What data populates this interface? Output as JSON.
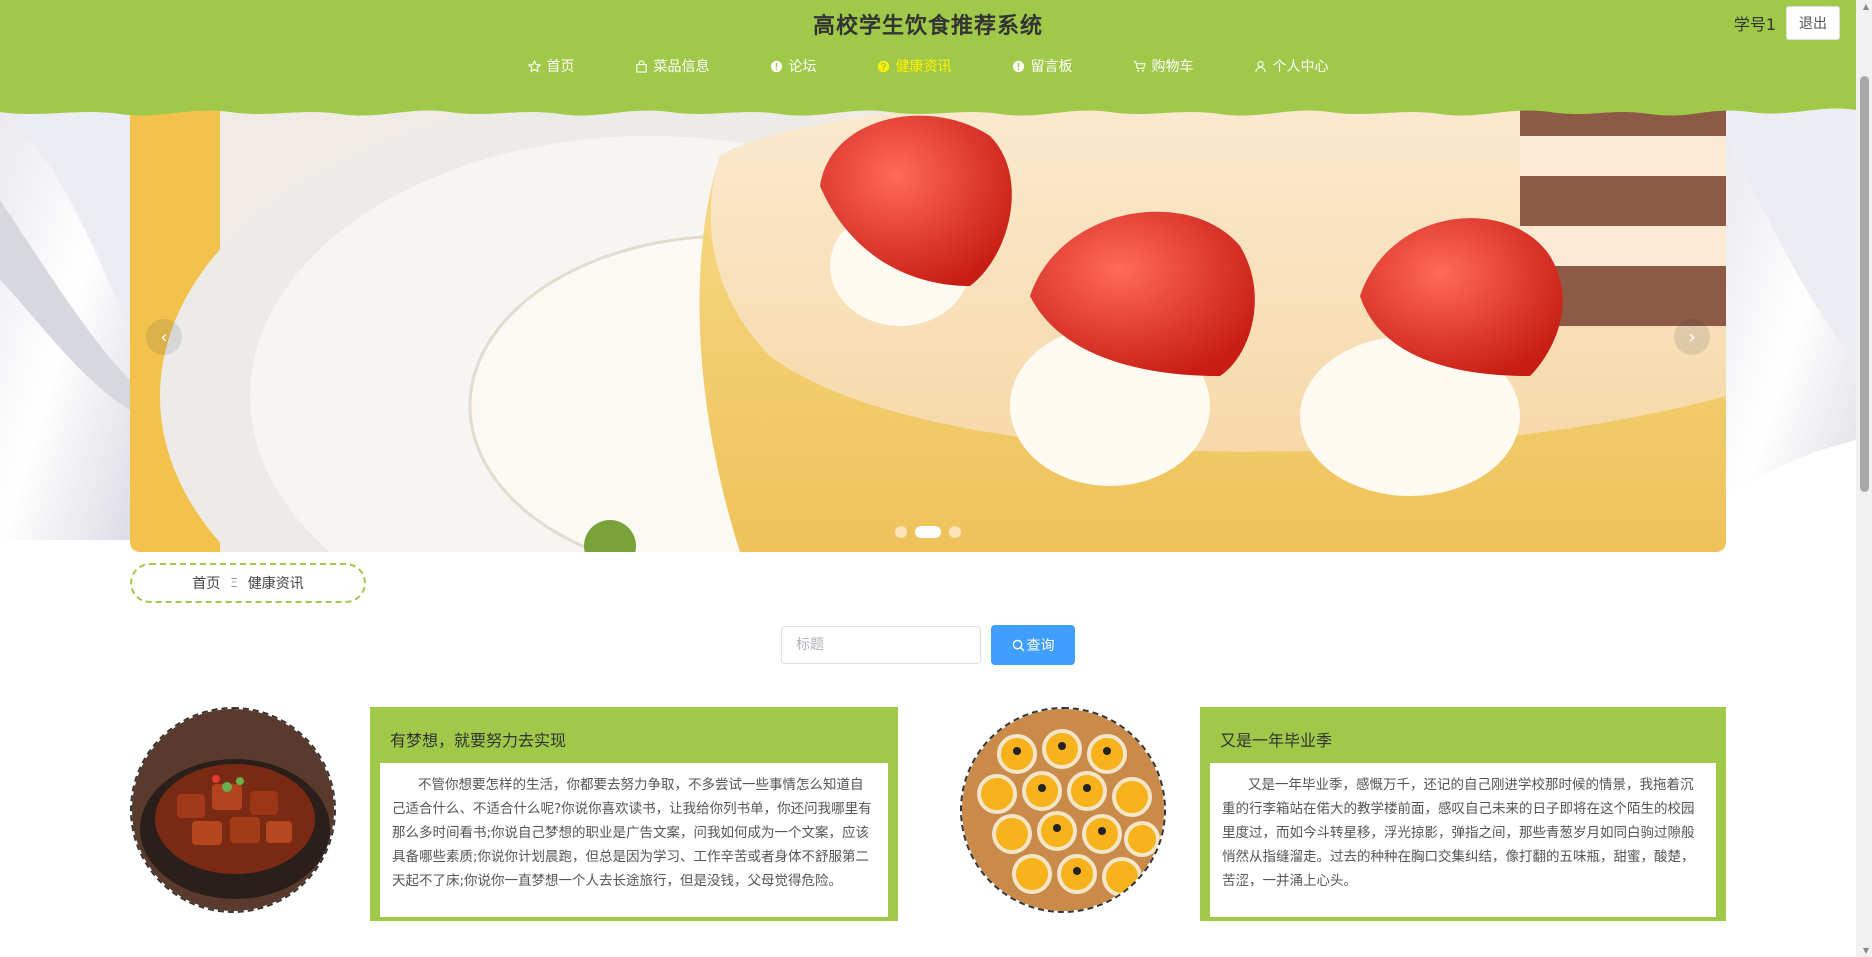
{
  "header": {
    "title": "高校学生饮食推荐系统",
    "username": "学号1",
    "logout_label": "退出",
    "bg_color": "#a0c94a",
    "active_color": "#fff200"
  },
  "nav": {
    "items": [
      {
        "label": "首页",
        "icon": "star-icon"
      },
      {
        "label": "菜品信息",
        "icon": "bag-icon"
      },
      {
        "label": "论坛",
        "icon": "info-icon"
      },
      {
        "label": "健康资讯",
        "icon": "question-icon",
        "active": true
      },
      {
        "label": "留言板",
        "icon": "info-icon"
      },
      {
        "label": "购物车",
        "icon": "cart-icon"
      },
      {
        "label": "个人中心",
        "icon": "user-icon"
      }
    ]
  },
  "carousel": {
    "prev_icon": "chevron-left-icon",
    "next_icon": "chevron-right-icon",
    "slide_count": 3,
    "active_slide": 2
  },
  "breadcrumb": {
    "home": "首页",
    "separator": "Ξ",
    "current": "健康资讯"
  },
  "search": {
    "placeholder": "标题",
    "value": "",
    "button_label": "查询"
  },
  "articles": [
    {
      "title": "有梦想，就要努力去实现",
      "body": "不管你想要怎样的生活，你都要去努力争取，不多尝试一些事情怎么知道自己适合什么、不适合什么呢?你说你喜欢读书，让我给你列书单，你还问我哪里有那么多时间看书;你说自己梦想的职业是广告文案，问我如何成为一个文案，应该具备哪些素质;你说你计划晨跑，但总是因为学习、工作辛苦或者身体不舒服第二天起不了床;你说你一直梦想一个人去长途旅行，但是没钱，父母觉得危险。"
    },
    {
      "title": "又是一年毕业季",
      "body": "又是一年毕业季，感慨万千，还记的自己刚进学校那时候的情景，我拖着沉重的行李箱站在偌大的教学楼前面，感叹自己未来的日子即将在这个陌生的校园里度过，而如今斗转星移，浮光掠影，弹指之间，那些青葱岁月如同白驹过隙般悄然从指缝溜走。过去的种种在胸口交集纠结，像打翻的五味瓶，甜蜜，酸楚，苦涩，一并涌上心头。"
    }
  ]
}
